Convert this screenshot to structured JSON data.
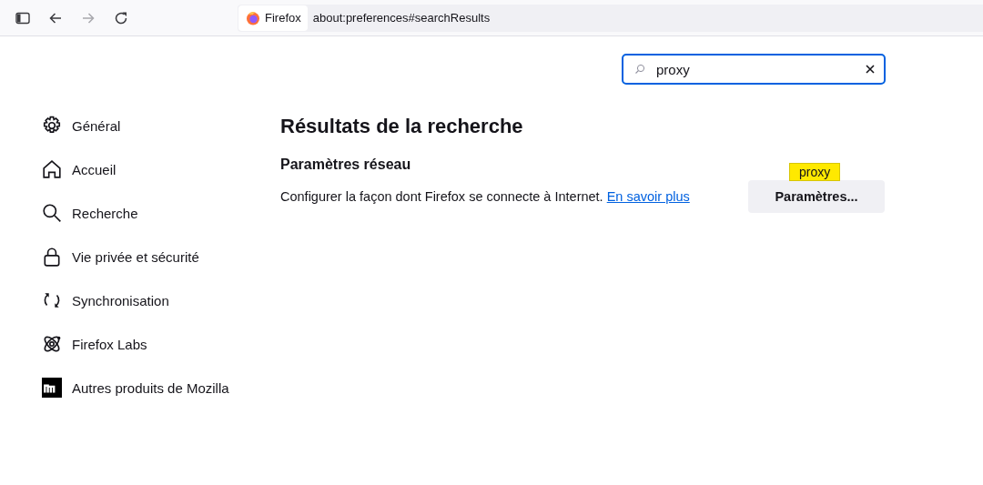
{
  "toolbar": {
    "identity_label": "Firefox",
    "url": "about:preferences#searchResults"
  },
  "search": {
    "value": "proxy"
  },
  "sidebar": {
    "items": [
      {
        "label": "Général",
        "kind": "gear"
      },
      {
        "label": "Accueil",
        "kind": "home"
      },
      {
        "label": "Recherche",
        "kind": "search"
      },
      {
        "label": "Vie privée et sécurité",
        "kind": "lock"
      },
      {
        "label": "Synchronisation",
        "kind": "sync"
      },
      {
        "label": "Firefox Labs",
        "kind": "atom"
      },
      {
        "label": "Autres produits de Mozilla",
        "kind": "mozilla"
      }
    ]
  },
  "main": {
    "title": "Résultats de la recherche",
    "section_title": "Paramètres réseau",
    "description": "Configurer la façon dont Firefox se connecte à Internet.",
    "link": "En savoir plus",
    "button": "Paramètres...",
    "highlight_badge": "proxy"
  }
}
